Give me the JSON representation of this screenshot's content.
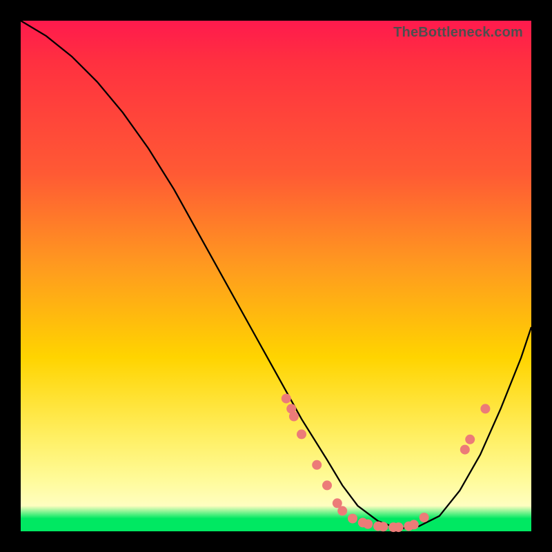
{
  "watermark": "TheBottleneck.com",
  "colors": {
    "background_outer": "#000000",
    "gradient_top": "#ff1a4d",
    "gradient_mid": "#ffd400",
    "gradient_bottom_band": "#00e862",
    "curve": "#000000",
    "dots": "#ec7b78",
    "watermark": "#4e4e4e"
  },
  "chart_data": {
    "type": "line",
    "title": "",
    "xlabel": "",
    "ylabel": "",
    "xlim": [
      0,
      100
    ],
    "ylim": [
      0,
      100
    ],
    "series": [
      {
        "name": "bottleneck-curve",
        "x": [
          0,
          5,
          10,
          15,
          20,
          25,
          30,
          35,
          40,
          45,
          50,
          55,
          60,
          63,
          66,
          70,
          74,
          78,
          82,
          86,
          90,
          94,
          98,
          100
        ],
        "y": [
          100,
          97,
          93,
          88,
          82,
          75,
          67,
          58,
          49,
          40,
          31,
          22,
          14,
          9,
          5,
          2,
          0.5,
          1,
          3,
          8,
          15,
          24,
          34,
          40
        ]
      }
    ],
    "scatter": [
      {
        "name": "points-on-curve",
        "points": [
          {
            "x": 52,
            "y": 26
          },
          {
            "x": 53,
            "y": 24
          },
          {
            "x": 53.5,
            "y": 22.5
          },
          {
            "x": 55,
            "y": 19
          },
          {
            "x": 58,
            "y": 13
          },
          {
            "x": 60,
            "y": 9
          },
          {
            "x": 62,
            "y": 5.5
          },
          {
            "x": 63,
            "y": 4
          },
          {
            "x": 65,
            "y": 2.5
          },
          {
            "x": 67,
            "y": 1.7
          },
          {
            "x": 68,
            "y": 1.4
          },
          {
            "x": 70,
            "y": 1.0
          },
          {
            "x": 71,
            "y": 0.9
          },
          {
            "x": 73,
            "y": 0.8
          },
          {
            "x": 74,
            "y": 0.8
          },
          {
            "x": 76,
            "y": 1.0
          },
          {
            "x": 77,
            "y": 1.3
          },
          {
            "x": 79,
            "y": 2.7
          },
          {
            "x": 87,
            "y": 16
          },
          {
            "x": 88,
            "y": 18
          },
          {
            "x": 91,
            "y": 24
          }
        ]
      }
    ],
    "annotations": [
      {
        "text": "TheBottleneck.com",
        "position": "top-right"
      }
    ]
  }
}
